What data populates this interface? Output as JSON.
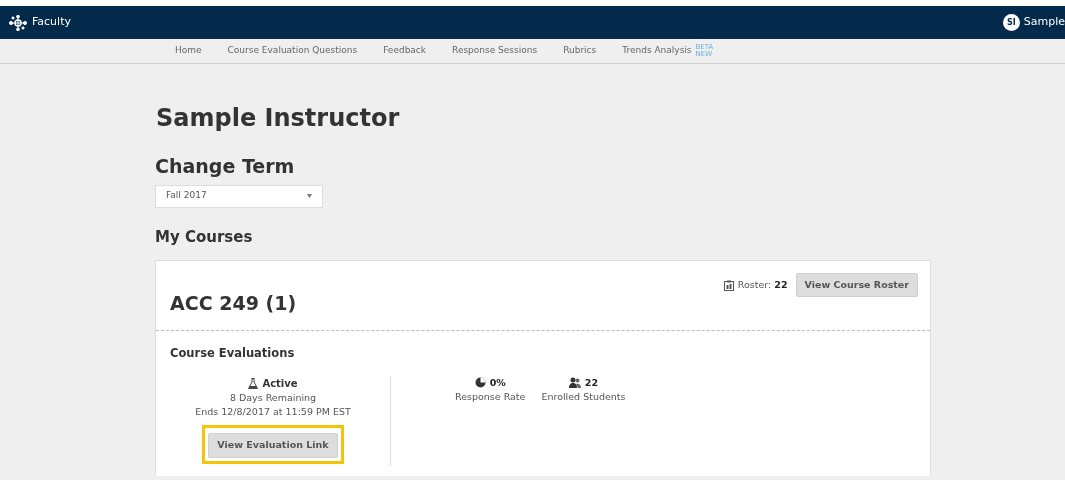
{
  "navbar": {
    "brand": "Faculty",
    "user_initials": "SI",
    "user_name": "Sample"
  },
  "subnav": [
    {
      "label": "Home"
    },
    {
      "label": "Course Evaluation Questions"
    },
    {
      "label": "Feedback"
    },
    {
      "label": "Response Sessions"
    },
    {
      "label": "Rubrics"
    },
    {
      "label": "Trends Analysis",
      "badges": [
        "BETA",
        "NEW"
      ]
    }
  ],
  "title": "Sample Instructor",
  "term": {
    "heading": "Change Term",
    "value": "Fall 2017"
  },
  "courses_heading": "My Courses",
  "courses": [
    {
      "name": "ACC 249 (1)",
      "roster_label": "Roster:",
      "roster_count": "22",
      "roster_button": "View Course Roster",
      "section_title": "Course Evaluations",
      "evaluation": {
        "status": "Active",
        "remaining": "8 Days Remaining",
        "ends": "Ends 12/8/2017 at 11:59 PM EST",
        "link_button": "View Evaluation Link",
        "highlighted": true
      },
      "stats": [
        {
          "kind": "rate",
          "value": "0%",
          "label": "Response Rate"
        },
        {
          "kind": "students",
          "value": "22",
          "label": "Enrolled Students"
        }
      ]
    }
  ]
}
